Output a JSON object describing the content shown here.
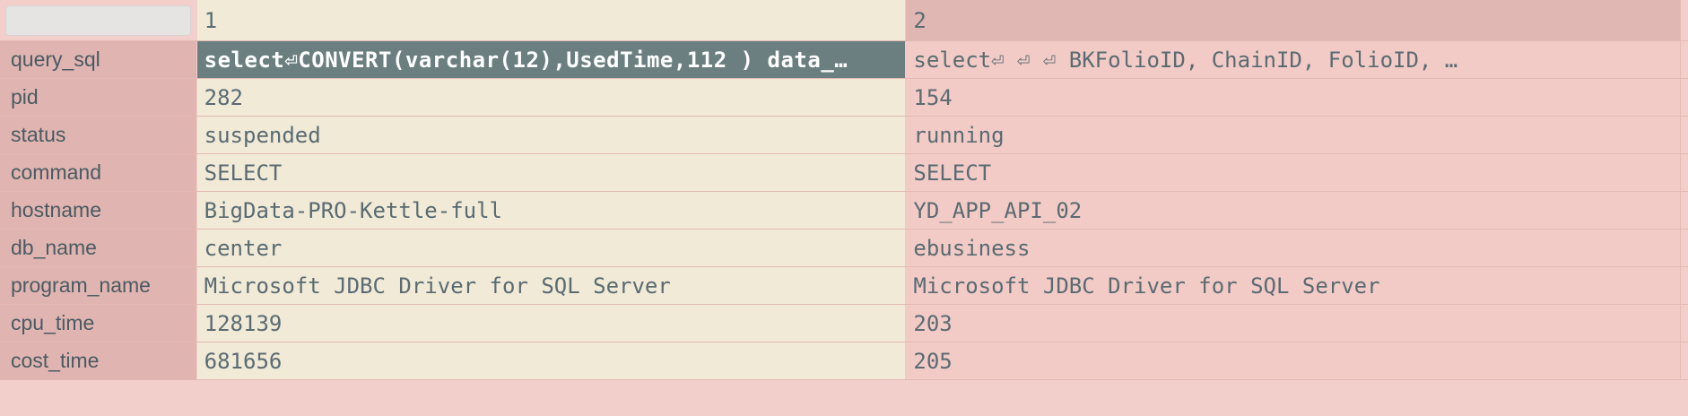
{
  "header": {
    "corner_box_label": "",
    "columns": [
      "1",
      "2"
    ]
  },
  "rows": [
    {
      "label": "query_sql",
      "values": [
        "select⏎CONVERT(varchar(12),UsedTime,112 ) data_…",
        "select⏎      ⏎      ⏎      BKFolioID, ChainID, FolioID, …"
      ]
    },
    {
      "label": "pid",
      "values": [
        "282",
        "154"
      ]
    },
    {
      "label": "status",
      "values": [
        "suspended",
        "running"
      ]
    },
    {
      "label": "command",
      "values": [
        "SELECT",
        "SELECT"
      ]
    },
    {
      "label": "hostname",
      "values": [
        "BigData-PRO-Kettle-full",
        "YD_APP_API_02"
      ]
    },
    {
      "label": "db_name",
      "values": [
        "center",
        "ebusiness"
      ]
    },
    {
      "label": "program_name",
      "values": [
        "Microsoft JDBC Driver for SQL Server",
        "Microsoft JDBC Driver for SQL Server"
      ]
    },
    {
      "label": "cpu_time",
      "values": [
        "128139",
        "203"
      ]
    },
    {
      "label": "cost_time",
      "values": [
        "681656",
        "205"
      ]
    }
  ],
  "colors": {
    "selected_bg": "#6b7f80",
    "col1_bg": "#f0ead7",
    "col2_bg": "#f2cbc6",
    "rowhead_bg": "#e0b5b1"
  }
}
